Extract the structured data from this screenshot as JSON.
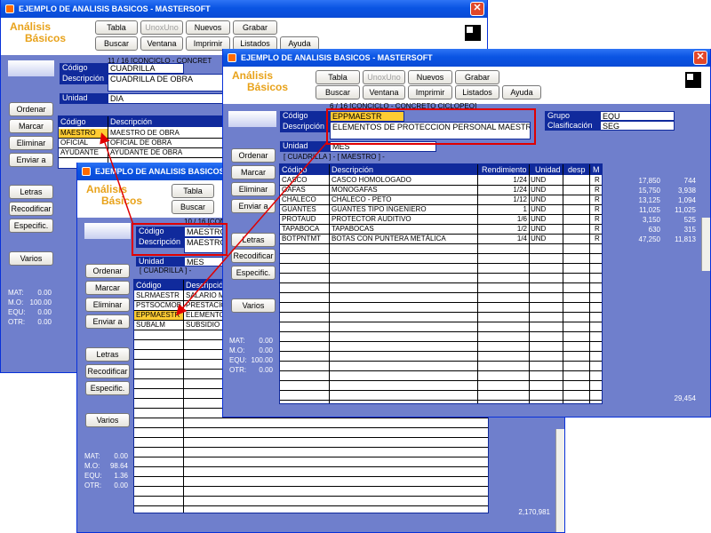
{
  "window_title": "EJEMPLO DE ANALISIS BASICOS - MASTERSOFT",
  "window_title_short": "EJEMPLO DE ANALISIS BASICOS - MA",
  "logo": {
    "line1": "Análisis",
    "line2": "Básicos"
  },
  "close_glyph": "✕",
  "toolbar": {
    "tabla": "Tabla",
    "unoxuno": "UnoxUno",
    "nuevos": "Nuevos",
    "grabar": "Grabar",
    "buscar": "Buscar",
    "ventana": "Ventana",
    "imprimir": "Imprimir",
    "listados": "Listados",
    "ayuda": "Ayuda"
  },
  "sidebar": {
    "ordenar": "Ordenar",
    "marcar": "Marcar",
    "eliminar": "Eliminar",
    "enviar": "Enviar a",
    "letras": "Letras",
    "recodificar": "Recodificar",
    "especific": "Especific.",
    "varios": "Varios"
  },
  "labels": {
    "codigo": "Código",
    "descripcion": "Descripción",
    "unidad": "Unidad",
    "grupo": "Grupo",
    "clasificacion": "Clasificación",
    "mat": "MAT:",
    "mo": "M.O:",
    "equ": "EQU:",
    "otr": "OTR:"
  },
  "win1": {
    "info": "11 / 16   [CONCICLO - CONCRET",
    "codigo": "CUADRILLA",
    "descripcion": "CUADRILLA DE OBRA",
    "unidad": "DIA",
    "grid_headers": [
      "Código",
      "Descripción"
    ],
    "rows": [
      [
        "MAESTRO",
        "MAESTRO DE OBRA"
      ],
      [
        "OFICIAL",
        "OFICIAL DE OBRA"
      ],
      [
        "AYUDANTE",
        "AYUDANTE DE OBRA"
      ]
    ],
    "mat": "0.00",
    "mo": "100.00",
    "equ": "0.00",
    "otr": "0.00"
  },
  "win2": {
    "info": "10 / 16   [CONCICLO - C",
    "codigo": "MAESTRO",
    "descripcion": "MAESTRO",
    "unidad": "MES",
    "breadcrumb": "[ CUADRILLA ] -",
    "grid_headers": [
      "Código",
      "Descripción"
    ],
    "rows": [
      [
        "SLRMAESTR",
        "SALARIO M"
      ],
      [
        "PSTSOCMOB",
        "PRESTACIO"
      ],
      [
        "EPPMAESTR",
        "ELEMENTO"
      ],
      [
        "SUBALM",
        "SUBSIDIO"
      ]
    ],
    "mat": "0.00",
    "mo": "98.64",
    "equ": "1.36",
    "otr": "0.00",
    "total": "2,170,981"
  },
  "win3": {
    "info": "6 / 16   [CONCICLO - CONCRETO CICLOPEO]",
    "codigo": "EPPMAESTR",
    "descripcion": "ELEMENTOS DE PROTECCION PERSONAL MAESTRO",
    "unidad": "MES",
    "grupo": "EQU",
    "clasificacion": "SEG",
    "breadcrumb": "[ CUADRILLA ] - [ MAESTRO ] -",
    "grid_headers": [
      "Código",
      "Descripción",
      "Rendimiento",
      "Unidad",
      "desp",
      "M"
    ],
    "rows": [
      [
        "CASCO",
        "CASCO HOMOLOGADO",
        "1/24",
        "UND",
        "",
        "R"
      ],
      [
        "GAFAS",
        "MONOGAFAS",
        "1/24",
        "UND",
        "",
        "R"
      ],
      [
        "CHALECO",
        "CHALECO - PETO",
        "1/12",
        "UND",
        "",
        "R"
      ],
      [
        "GUANTES",
        "GUANTES TIPO INGENIERO",
        "1",
        "UND",
        "",
        "R"
      ],
      [
        "PROTAUD",
        "PROTECTOR AUDITIVO",
        "1/6",
        "UND",
        "",
        "R"
      ],
      [
        "TAPABOCA",
        "TAPABOCAS",
        "1/2",
        "UND",
        "",
        "R"
      ],
      [
        "BOTPNTMT",
        "BOTAS CON PUNTERA METÁLICA",
        "1/4",
        "UND",
        "",
        "R"
      ]
    ],
    "prices": [
      [
        "17,850",
        "744"
      ],
      [
        "15,750",
        "3,938"
      ],
      [
        "13,125",
        "1,094"
      ],
      [
        "11,025",
        "11,025"
      ],
      [
        "3,150",
        "525"
      ],
      [
        "630",
        "315"
      ],
      [
        "47,250",
        "11,813"
      ]
    ],
    "mat": "0.00",
    "mo": "0.00",
    "equ": "100.00",
    "otr": "0.00",
    "total": "29,454"
  },
  "colors": {
    "window_bg": "#6f7fcc",
    "header_blue": "#102a9c",
    "highlight": "#ffcc33",
    "annotation_red": "#e00000",
    "logo_orange": "#e8a21a"
  }
}
